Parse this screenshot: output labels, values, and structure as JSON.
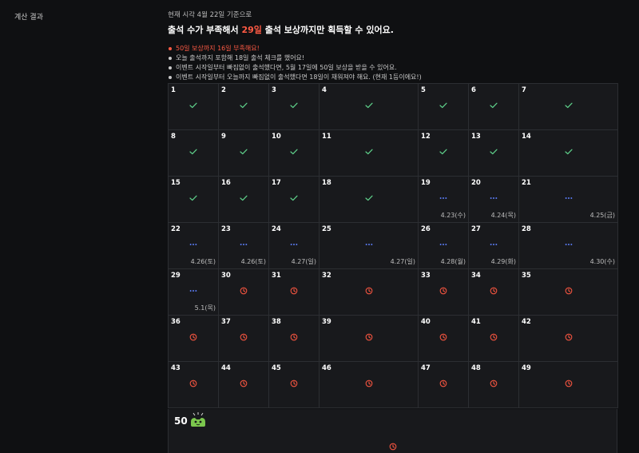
{
  "sidebar": {
    "section_label": "계산 결과"
  },
  "summary": {
    "basis_text": "현재 시각 4월 22일 기준으로",
    "headline": {
      "prefix": "출석 수가 부족해서 ",
      "accent": "29일",
      "suffix": " 출석 보상까지만 획득할 수 있어요."
    },
    "bullets": [
      {
        "text": "50일 보상까지 16일 부족해요!",
        "tone": "warn"
      },
      {
        "text": "오늘 출석까지 포함해 18일 출석 체크를 했어요!",
        "tone": "normal"
      },
      {
        "text": "이벤트 시작일부터 빠짐없이 출석했다면, 5월 17일에 50일 보상을 받을 수 있어요.",
        "tone": "normal"
      },
      {
        "text": "이벤트 시작일부터 오늘까지 빠짐없이 출석했다면 18일이 채워져야 해요. (현재 1등이에요!)",
        "tone": "normal"
      }
    ]
  },
  "colors": {
    "check": "#5ed08a",
    "pending": "#5b7cf5",
    "missed": "#f0533f",
    "accent": "#ff5a44"
  },
  "calendar": {
    "days": [
      {
        "day": "1",
        "status": "check",
        "date": ""
      },
      {
        "day": "2",
        "status": "check",
        "date": ""
      },
      {
        "day": "3",
        "status": "check",
        "date": ""
      },
      {
        "day": "4",
        "status": "check",
        "date": ""
      },
      {
        "day": "5",
        "status": "check",
        "date": ""
      },
      {
        "day": "6",
        "status": "check",
        "date": ""
      },
      {
        "day": "7",
        "status": "check",
        "date": ""
      },
      {
        "day": "8",
        "status": "check",
        "date": ""
      },
      {
        "day": "9",
        "status": "check",
        "date": ""
      },
      {
        "day": "10",
        "status": "check",
        "date": ""
      },
      {
        "day": "11",
        "status": "check",
        "date": ""
      },
      {
        "day": "12",
        "status": "check",
        "date": ""
      },
      {
        "day": "13",
        "status": "check",
        "date": ""
      },
      {
        "day": "14",
        "status": "check",
        "date": ""
      },
      {
        "day": "15",
        "status": "check",
        "date": ""
      },
      {
        "day": "16",
        "status": "check",
        "date": ""
      },
      {
        "day": "17",
        "status": "check",
        "date": ""
      },
      {
        "day": "18",
        "status": "check",
        "date": ""
      },
      {
        "day": "19",
        "status": "pending",
        "date": "4.23(수)"
      },
      {
        "day": "20",
        "status": "pending",
        "date": "4.24(목)"
      },
      {
        "day": "21",
        "status": "pending",
        "date": "4.25(금)"
      },
      {
        "day": "22",
        "status": "pending",
        "date": "4.26(토)"
      },
      {
        "day": "23",
        "status": "pending",
        "date": "4.26(토)"
      },
      {
        "day": "24",
        "status": "pending",
        "date": "4.27(일)"
      },
      {
        "day": "25",
        "status": "pending",
        "date": "4.27(일)"
      },
      {
        "day": "26",
        "status": "pending",
        "date": "4.28(월)"
      },
      {
        "day": "27",
        "status": "pending",
        "date": "4.29(화)"
      },
      {
        "day": "28",
        "status": "pending",
        "date": "4.30(수)"
      },
      {
        "day": "29",
        "status": "pending",
        "date": "5.1(목)"
      },
      {
        "day": "30",
        "status": "missed",
        "date": ""
      },
      {
        "day": "31",
        "status": "missed",
        "date": ""
      },
      {
        "day": "32",
        "status": "missed",
        "date": ""
      },
      {
        "day": "33",
        "status": "missed",
        "date": ""
      },
      {
        "day": "34",
        "status": "missed",
        "date": ""
      },
      {
        "day": "35",
        "status": "missed",
        "date": ""
      },
      {
        "day": "36",
        "status": "missed",
        "date": ""
      },
      {
        "day": "37",
        "status": "missed",
        "date": ""
      },
      {
        "day": "38",
        "status": "missed",
        "date": ""
      },
      {
        "day": "39",
        "status": "missed",
        "date": ""
      },
      {
        "day": "40",
        "status": "missed",
        "date": ""
      },
      {
        "day": "41",
        "status": "missed",
        "date": ""
      },
      {
        "day": "42",
        "status": "missed",
        "date": ""
      },
      {
        "day": "43",
        "status": "missed",
        "date": ""
      },
      {
        "day": "44",
        "status": "missed",
        "date": ""
      },
      {
        "day": "45",
        "status": "missed",
        "date": ""
      },
      {
        "day": "46",
        "status": "missed",
        "date": ""
      },
      {
        "day": "47",
        "status": "missed",
        "date": ""
      },
      {
        "day": "48",
        "status": "missed",
        "date": ""
      },
      {
        "day": "49",
        "status": "missed",
        "date": ""
      }
    ],
    "reward": {
      "day": "50",
      "status": "missed",
      "icon": "reward-character-icon"
    }
  }
}
